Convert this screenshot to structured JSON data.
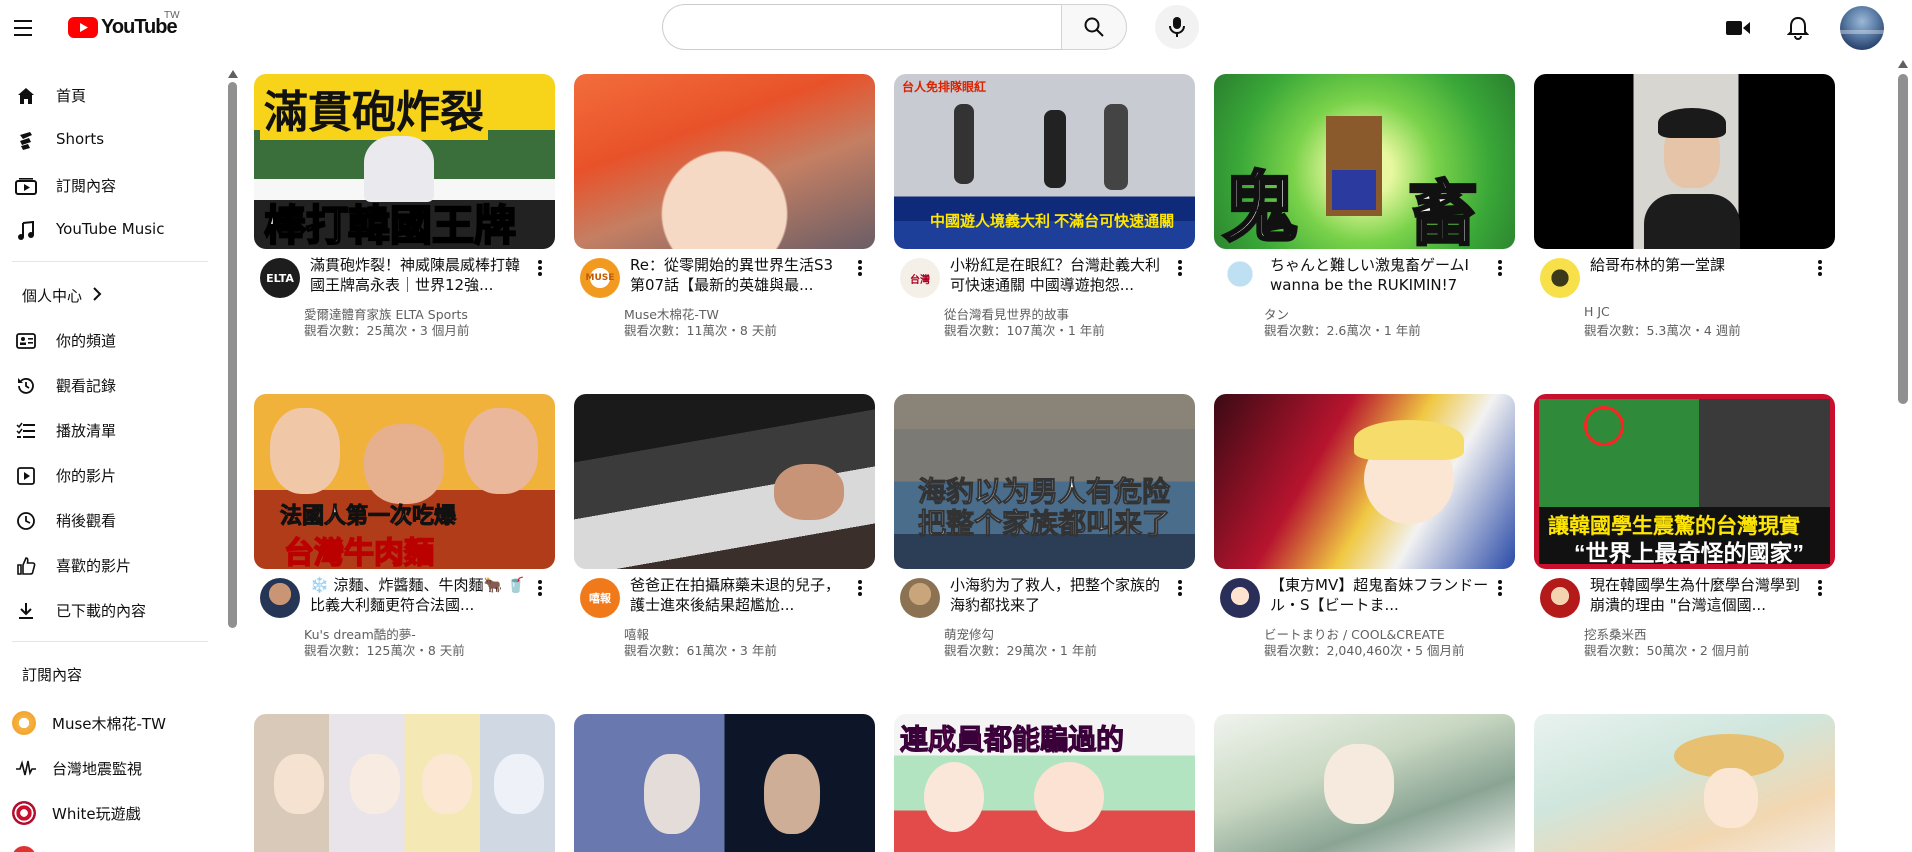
{
  "header": {
    "logo_text": "YouTube",
    "region": "TW",
    "search_value": "",
    "search_placeholder": ""
  },
  "sidebar": {
    "main": [
      {
        "label": "首頁",
        "icon": "home-icon"
      },
      {
        "label": "Shorts",
        "icon": "shorts-icon"
      },
      {
        "label": "訂閱內容",
        "icon": "subscriptions-icon"
      },
      {
        "label": "YouTube Music",
        "icon": "music-icon"
      }
    ],
    "you_heading": "個人中心",
    "you": [
      {
        "label": "你的頻道",
        "icon": "channel-icon"
      },
      {
        "label": "觀看記錄",
        "icon": "history-icon"
      },
      {
        "label": "播放清單",
        "icon": "playlist-icon"
      },
      {
        "label": "你的影片",
        "icon": "your-videos-icon"
      },
      {
        "label": "稍後觀看",
        "icon": "watch-later-icon"
      },
      {
        "label": "喜歡的影片",
        "icon": "liked-icon"
      },
      {
        "label": "已下載的內容",
        "icon": "download-icon"
      }
    ],
    "subs_heading": "訂閱內容",
    "subs": [
      {
        "label": "Muse木棉花-TW"
      },
      {
        "label": "台灣地震監視"
      },
      {
        "label": "White玩遊戲"
      }
    ]
  },
  "videos": [
    {
      "thumb_text": "滿貫砲炸裂",
      "thumb_sub": "棒打韓國王牌",
      "title": "滿貫砲炸裂！神威陳晨威棒打韓國王牌高永表｜世界12強...",
      "channel": "愛爾達體育家族 ELTA Sports",
      "meta": "觀看次數：25萬次・3 個月前",
      "avatar_text": "ELTA"
    },
    {
      "thumb_text": "",
      "thumb_sub": "",
      "title": "Re：從零開始的異世界生活S3 第07話【最新的英雄與最...",
      "channel": "Muse木棉花-TW",
      "meta": "觀看次數：11萬次・8 天前",
      "avatar_text": "MUSE"
    },
    {
      "thumb_text": "中國遊人境義大利 不滿台可快速通關",
      "thumb_sub": "台人免排隊眼紅",
      "title": "小粉紅是在眼紅？台灣赴義大利可快速通關 中國導遊抱怨...",
      "channel": "從台灣看見世界的故事",
      "meta": "觀看次數：107萬次・1 年前",
      "avatar_text": "台灣"
    },
    {
      "thumb_text": "鬼",
      "thumb_sub": "畜",
      "title": "ちゃんと難しい激鬼畜ゲームI wanna be the RUKIMIN!7",
      "channel": "タン",
      "meta": "觀看次數：2.6萬次・1 年前",
      "avatar_text": ""
    },
    {
      "thumb_text": "",
      "thumb_sub": "",
      "title": "給哥布林的第一堂課",
      "channel": "H JC",
      "meta": "觀看次數：5.3萬次・4 週前",
      "avatar_text": ""
    },
    {
      "thumb_text": "法國人第一次吃爆",
      "thumb_sub": "台灣牛肉麵",
      "title": "❄️ 涼麵、炸醬麵、牛肉麵🐂 🥤比義大利麵更符合法國...",
      "channel": "Ku's dream酷的夢-",
      "meta": "觀看次數：125萬次・8 天前",
      "avatar_text": ""
    },
    {
      "thumb_text": "",
      "thumb_sub": "",
      "title": "爸爸正在拍攝麻藥未退的兒子，護士進來後結果超尷尬...",
      "channel": "嘻報",
      "meta": "觀看次數：61萬次・3 年前",
      "avatar_text": "嘻報"
    },
    {
      "thumb_text": "海豹以为男人有危险",
      "thumb_sub": "把整个家族都叫来了",
      "title": "小海豹为了救人，把整个家族的海豹都找来了",
      "channel": "萌宠修勾",
      "meta": "觀看次數：29萬次・1 年前",
      "avatar_text": ""
    },
    {
      "thumb_text": "",
      "thumb_sub": "",
      "title": "【東方MV】超鬼畜妹フランドール・S【ビートま...",
      "channel": "ビートまりお / COOL&CREATE",
      "meta": "觀看次數：2,040,460次・5 個月前",
      "avatar_text": ""
    },
    {
      "thumb_text": "讓韓國學生震驚的台灣現實",
      "thumb_sub": "“世界上最奇怪的國家”",
      "title": "現在韓國學生為什麼學台灣學到崩潰的理由 \"台灣這個國...",
      "channel": "挖系桑米西",
      "meta": "觀看次數：50萬次・2 個月前",
      "avatar_text": ""
    },
    {
      "thumb_text": "",
      "thumb_sub": "",
      "title": "",
      "channel": "",
      "meta": "",
      "avatar_text": ""
    },
    {
      "thumb_text": "",
      "thumb_sub": "",
      "title": "",
      "channel": "",
      "meta": "",
      "avatar_text": ""
    },
    {
      "thumb_text": "連成員都能騙過的",
      "thumb_sub": "",
      "title": "",
      "channel": "",
      "meta": "",
      "avatar_text": ""
    },
    {
      "thumb_text": "",
      "thumb_sub": "",
      "title": "",
      "channel": "",
      "meta": "",
      "avatar_text": ""
    },
    {
      "thumb_text": "",
      "thumb_sub": "",
      "title": "",
      "channel": "",
      "meta": "",
      "avatar_text": ""
    }
  ],
  "colors": {
    "brand_red": "#ff0000",
    "text_primary": "#0f0f0f",
    "text_secondary": "#606060"
  }
}
